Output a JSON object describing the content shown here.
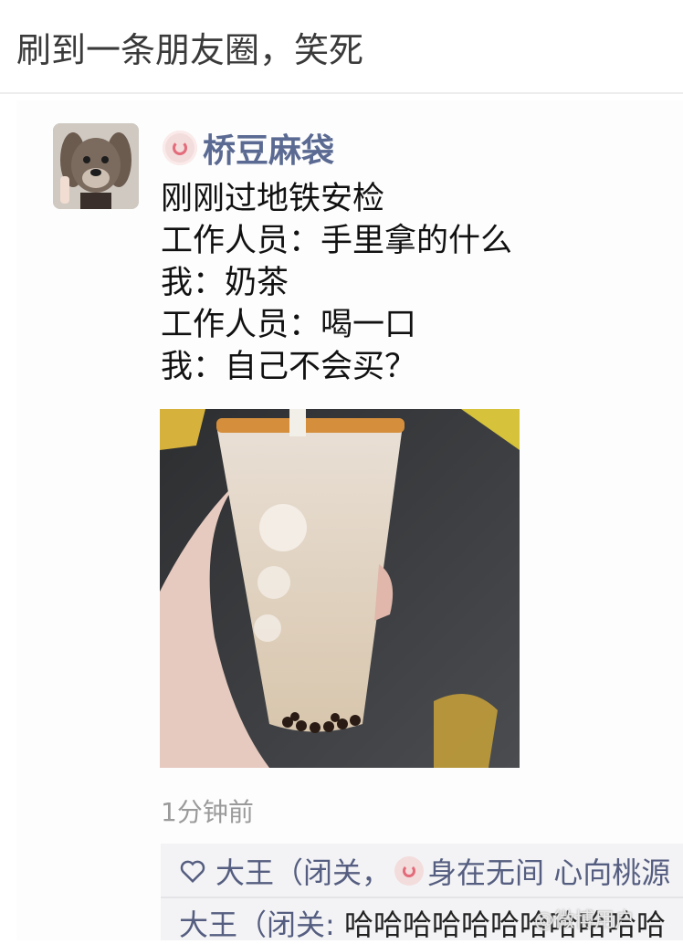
{
  "header": {
    "title": "刷到一条朋友圈，笑死"
  },
  "post": {
    "avatar_icon": "dog-avatar",
    "name_icon": "pink-swirl-icon",
    "username": "桥豆麻袋",
    "lines": [
      "刚刚过地铁安检",
      "工作人员：手里拿的什么",
      "我：奶茶",
      "工作人员：喝一口",
      "我：自己不会买？"
    ],
    "photo_icon": "milk-tea-cup-photo",
    "timestamp": "1分钟前"
  },
  "comments": {
    "like_icon": "heart-outline-icon",
    "likes_prefix": "大王（闭关，",
    "likes_suffix": "身在无间 心向桃源",
    "comment": {
      "author": "大王（闭关:",
      "text": " 哈哈哈哈哈哈哈哈哈哈哈"
    }
  },
  "watermark": "@微博用户"
}
